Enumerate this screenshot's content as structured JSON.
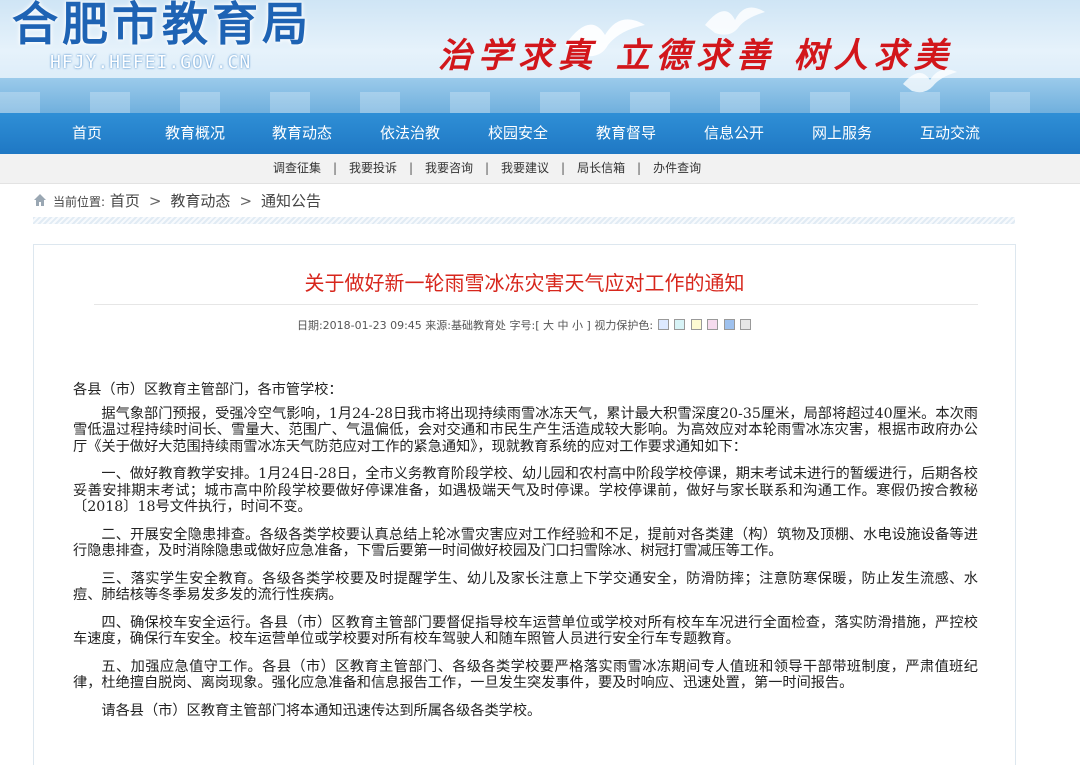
{
  "banner": {
    "site_title": "合肥市教育局",
    "site_url": "HFJY.HEFEI.GOV.CN",
    "slogan": "治学求真 立德求善 树人求美"
  },
  "nav": {
    "items": [
      "首页",
      "教育概况",
      "教育动态",
      "依法治教",
      "校园安全",
      "教育督导",
      "信息公开",
      "网上服务",
      "互动交流"
    ]
  },
  "subnav": {
    "items": [
      "调查征集",
      "我要投诉",
      "我要咨询",
      "我要建议",
      "局长信箱",
      "办件查询"
    ],
    "separator": "|"
  },
  "breadcrumb": {
    "label": "当前位置:",
    "items": [
      "首页",
      "教育动态",
      "通知公告"
    ],
    "arrow": ">"
  },
  "article": {
    "title": "关于做好新一轮雨雪冰冻灾害天气应对工作的通知",
    "meta": {
      "date_label": "日期:",
      "date": "2018-01-23 09:45",
      "source_label": "来源:",
      "source": "基础教育处",
      "font_label": "字号:",
      "font_sizes": [
        "[",
        "大",
        "中",
        "小",
        "]"
      ],
      "eye_label": "视力保护色:",
      "eye_colors": [
        "#dde9ff",
        "#d7f3f6",
        "#fdfbd2",
        "#f6dbee",
        "#9ec1ee",
        "#e6e6e6"
      ]
    },
    "greeting": "各县（市）区教育主管部门，各市管学校：",
    "paragraphs": [
      "据气象部门预报，受强冷空气影响，1月24-28日我市将出现持续雨雪冰冻天气，累计最大积雪深度20-35厘米，局部将超过40厘米。本次雨雪低温过程持续时间长、雪量大、范围广、气温偏低，会对交通和市民生产生活造成较大影响。为高效应对本轮雨雪冰冻灾害，根据市政府办公厅《关于做好大范围持续雨雪冰冻天气防范应对工作的紧急通知》，现就教育系统的应对工作要求通知如下：",
      "一、做好教育教学安排。1月24日-28日，全市义务教育阶段学校、幼儿园和农村高中阶段学校停课，期末考试未进行的暂缓进行，后期各校妥善安排期末考试；城市高中阶段学校要做好停课准备，如遇极端天气及时停课。学校停课前，做好与家长联系和沟通工作。寒假仍按合教秘〔2018〕18号文件执行，时间不变。",
      "二、开展安全隐患排查。各级各类学校要认真总结上轮冰雪灾害应对工作经验和不足，提前对各类建（构）筑物及顶棚、水电设施设备等进行隐患排查，及时消除隐患或做好应急准备，下雪后要第一时间做好校园及门口扫雪除冰、树冠打雪减压等工作。",
      "三、落实学生安全教育。各级各类学校要及时提醒学生、幼儿及家长注意上下学交通安全，防滑防摔；注意防寒保暖，防止发生流感、水痘、肺结核等冬季易发多发的流行性疾病。",
      "四、确保校车安全运行。各县（市）区教育主管部门要督促指导校车运营单位或学校对所有校车车况进行全面检查，落实防滑措施，严控校车速度，确保行车安全。校车运营单位或学校要对所有校车驾驶人和随车照管人员进行安全行车专题教育。",
      "五、加强应急值守工作。各县（市）区教育主管部门、各级各类学校要严格落实雨雪冰冻期间专人值班和领导干部带班制度，严肃值班纪律，杜绝擅自脱岗、离岗现象。强化应急准备和信息报告工作，一旦发生突发事件，要及时响应、迅速处置，第一时间报告。",
      "请各县（市）区教育主管部门将本通知迅速传达到所属各级各类学校。"
    ]
  }
}
